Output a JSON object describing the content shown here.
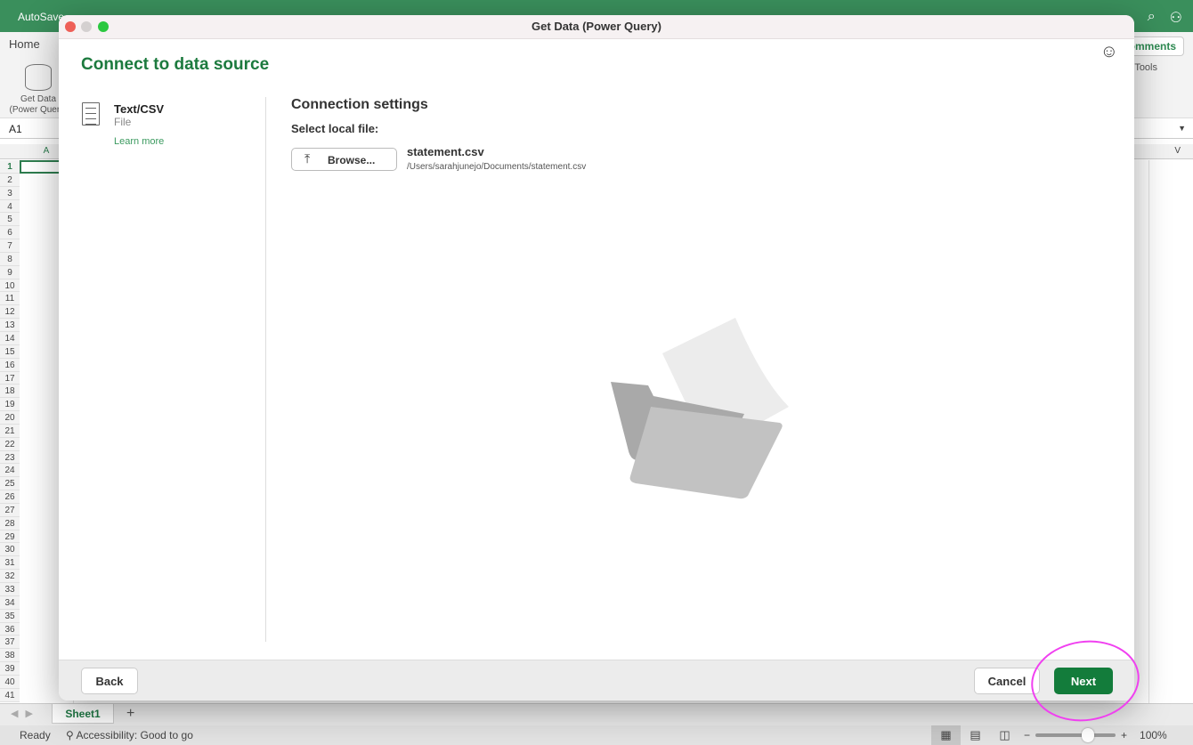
{
  "excel": {
    "autosave_label": "AutoSave",
    "ribbon_tab": "Home",
    "get_data_label": "Get Data (Power Query)",
    "comments_label": "Comments",
    "tools_label": "Tools",
    "name_box": "A1",
    "column_first": "A",
    "column_last": "V",
    "row_numbers": [
      "1",
      "2",
      "3",
      "4",
      "5",
      "6",
      "7",
      "8",
      "9",
      "10",
      "11",
      "12",
      "13",
      "14",
      "15",
      "16",
      "17",
      "18",
      "19",
      "20",
      "21",
      "22",
      "23",
      "24",
      "25",
      "26",
      "27",
      "28",
      "29",
      "30",
      "31",
      "32",
      "33",
      "34",
      "35",
      "36",
      "37",
      "38",
      "39",
      "40",
      "41"
    ],
    "sheet_tab": "Sheet1",
    "add_sheet": "+",
    "status_ready": "Ready",
    "status_accessibility": "Accessibility: Good to go",
    "zoom_level": "100%"
  },
  "dialog": {
    "window_title": "Get Data (Power Query)",
    "heading": "Connect to data source",
    "source": {
      "name": "Text/CSV",
      "type": "File",
      "learn_more": "Learn more"
    },
    "connection_settings": "Connection settings",
    "select_local_file": "Select local file:",
    "browse_label": "Browse...",
    "file_name": "statement.csv",
    "file_path": "/Users/sarahjunejo/Documents/statement.csv",
    "back_label": "Back",
    "cancel_label": "Cancel",
    "next_label": "Next"
  },
  "colors": {
    "excel_green": "#3a8f5c",
    "accent": "#1c7a3e",
    "next_button": "#137c3b",
    "highlight_circle": "#f040f0"
  }
}
